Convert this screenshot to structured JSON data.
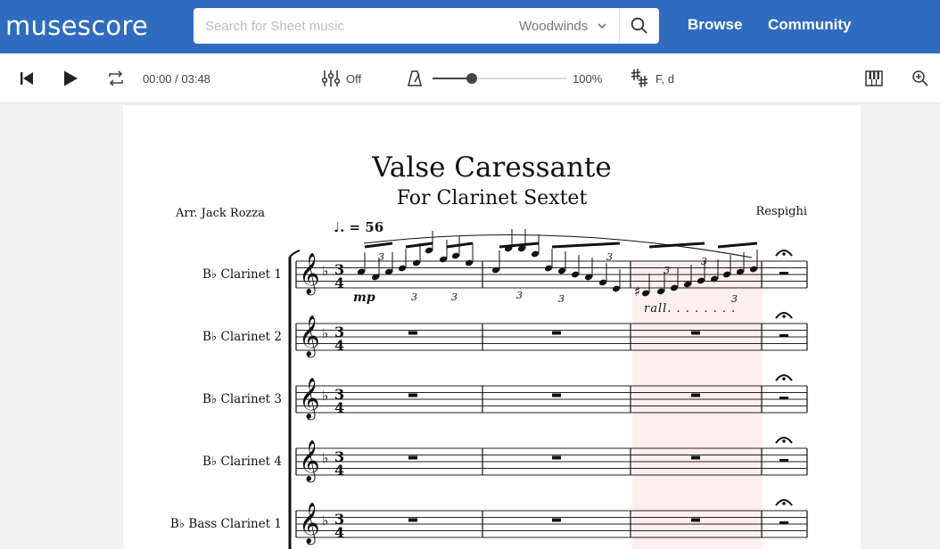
{
  "header": {
    "logo": "musescore",
    "search_placeholder": "Search for Sheet music",
    "category": "Woodwinds",
    "nav": [
      "Browse",
      "Community"
    ]
  },
  "player": {
    "time": "00:00 / 03:48",
    "mixer_state": "Off",
    "tempo_percent": "100%",
    "tempo_fraction": 0.29,
    "key": "F, d"
  },
  "score": {
    "title": "Valse Caressante",
    "subtitle": "For Clarinet Sextet",
    "arranger": "Arr. Jack Rozza",
    "composer": "Respighi",
    "tempo_mark": "♩. = 56",
    "dynamic": "mp",
    "rall": "rall. . . . . . . .",
    "instruments": [
      "B♭ Clarinet 1",
      "B♭ Clarinet 2",
      "B♭ Clarinet 3",
      "B♭ Clarinet 4",
      "B♭ Bass Clarinet 1"
    ],
    "tuplet": "3"
  },
  "colors": {
    "brand": "#2f6cc0",
    "highlight": "#fdeeee"
  },
  "icons": [
    "skip-back-icon",
    "play-icon",
    "loop-icon",
    "mixer-icon",
    "metronome-icon",
    "key-signature-icon",
    "piano-keyboard-icon",
    "zoom-in-icon",
    "search-icon",
    "chevron-down-icon"
  ]
}
